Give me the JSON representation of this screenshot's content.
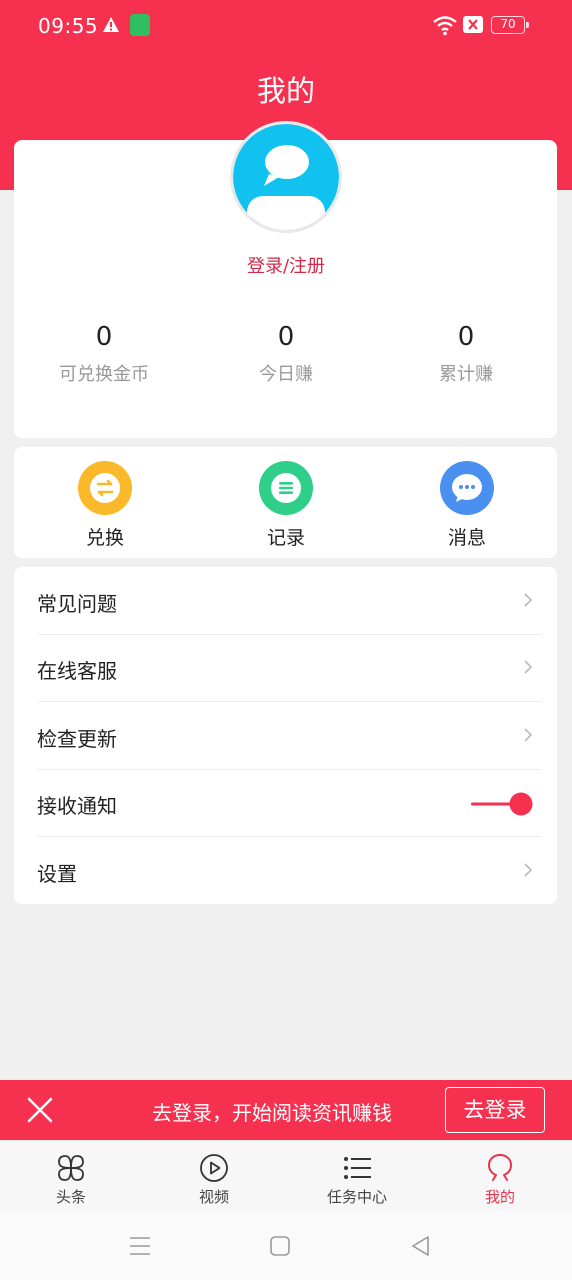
{
  "status_bar": {
    "time": "09:55",
    "battery": "70"
  },
  "header": {
    "title": "我的"
  },
  "profile": {
    "login_label": "登录/注册",
    "stats": [
      {
        "value": "0",
        "label": "可兑换金币"
      },
      {
        "value": "0",
        "label": "今日赚"
      },
      {
        "value": "0",
        "label": "累计赚"
      }
    ]
  },
  "actions": [
    {
      "label": "兑换",
      "icon": "exchange-icon",
      "color": "#f9b92b"
    },
    {
      "label": "记录",
      "icon": "list-icon",
      "color": "#2fcf8a"
    },
    {
      "label": "消息",
      "icon": "message-icon",
      "color": "#4a90f0"
    }
  ],
  "menu": [
    {
      "label": "常见问题"
    },
    {
      "label": "在线客服"
    },
    {
      "label": "检查更新"
    },
    {
      "label": "接收通知",
      "toggle": true
    },
    {
      "label": "设置"
    }
  ],
  "banner": {
    "text": "去登录，开始阅读资讯赚钱",
    "button": "去登录"
  },
  "tabs": [
    {
      "label": "头条",
      "icon": "clover-icon"
    },
    {
      "label": "视频",
      "icon": "play-icon"
    },
    {
      "label": "任务中心",
      "icon": "task-list-icon"
    },
    {
      "label": "我的",
      "icon": "profile-icon",
      "active": true
    }
  ],
  "colors": {
    "brand": "#f5314f",
    "active_tab": "#e8334f"
  }
}
